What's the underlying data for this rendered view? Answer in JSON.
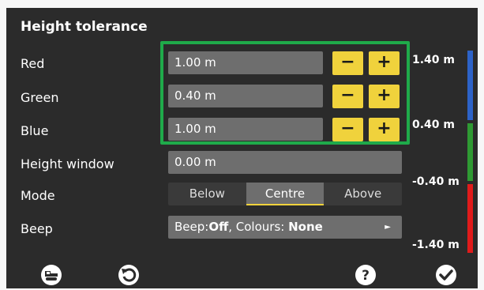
{
  "title": "Height tolerance",
  "rows": {
    "red": {
      "label": "Red",
      "value": "1.00 m"
    },
    "green": {
      "label": "Green",
      "value": "0.40 m"
    },
    "blue": {
      "label": "Blue",
      "value": "1.00 m"
    },
    "height_window": {
      "label": "Height window",
      "value": "0.00 m"
    }
  },
  "buttons": {
    "minus": "−",
    "plus": "+"
  },
  "mode": {
    "label": "Mode",
    "options": [
      "Below",
      "Centre",
      "Above"
    ],
    "selected": "Centre"
  },
  "beep": {
    "label": "Beep",
    "beep_key": "Beep:",
    "beep_value": "Off",
    "sep": ", Colours:",
    "colours_value": "None",
    "arrow": "►"
  },
  "scale": {
    "labels": [
      "1.40 m",
      "0.40 m",
      "-0.40 m",
      "-1.40 m"
    ],
    "colors": {
      "blue": "#2d63c8",
      "green": "#2f9a33",
      "red": "#e01b1b"
    }
  },
  "toolbar": {
    "icons": [
      "machine-icon",
      "reset-icon",
      "help-icon",
      "confirm-icon"
    ]
  }
}
